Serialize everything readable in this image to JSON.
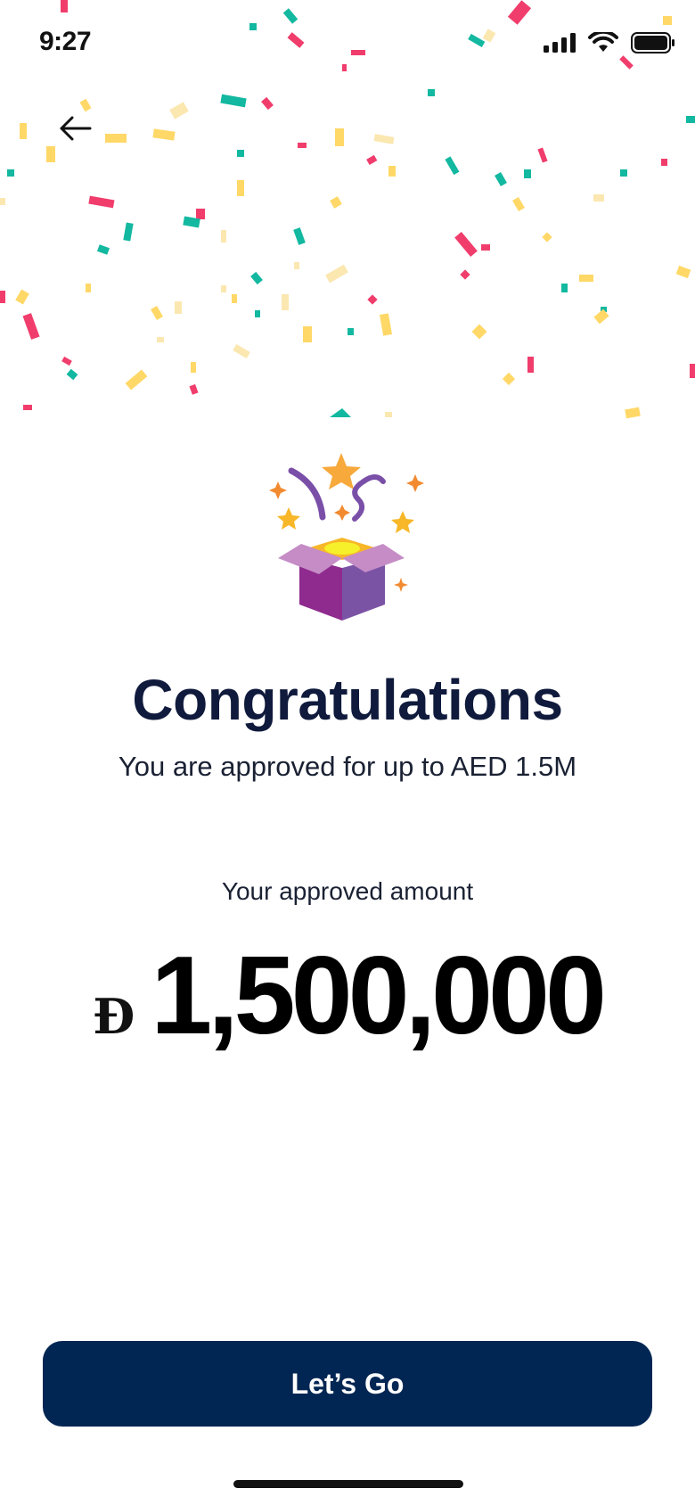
{
  "status_bar": {
    "time": "9:27"
  },
  "header": {
    "back_icon": "arrow-left-icon"
  },
  "hero": {
    "icon": "gift-box-celebration-icon",
    "confetti_colors": [
      "#f03d6c",
      "#13b8a0",
      "#ffd867",
      "#fbe7b0"
    ]
  },
  "main": {
    "title": "Congratulations",
    "subtitle": "You are approved for up to AED 1.5M",
    "amount_label": "Your approved amount",
    "currency_symbol": "Đ",
    "amount": "1,500,000"
  },
  "footer": {
    "cta_label": "Let’s Go",
    "cta_color": "#022653"
  }
}
